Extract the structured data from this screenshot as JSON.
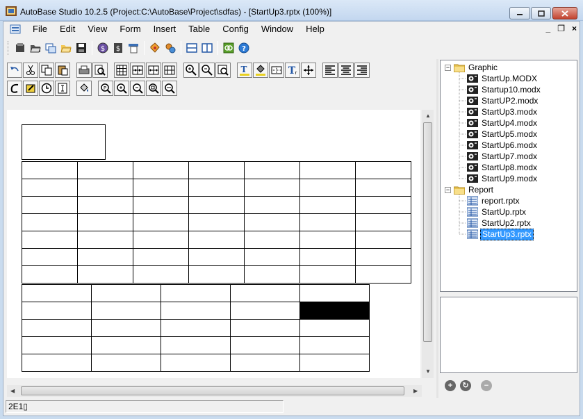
{
  "window": {
    "title": "AutoBase Studio 10.2.5 (Project:C:\\AutoBase\\Project\\sdfas) - [StartUp3.rptx (100%)]"
  },
  "menu": {
    "items": [
      "File",
      "Edit",
      "View",
      "Form",
      "Insert",
      "Table",
      "Config",
      "Window",
      "Help"
    ],
    "mdi_minimize": "_",
    "mdi_restore": "❐",
    "mdi_close": "×"
  },
  "toolbar_main": {
    "icons": [
      "new-project-icon",
      "open-folder-icon",
      "copy-window-icon",
      "open-file-icon",
      "save-icon",
      "dollar-coin-icon",
      "dollar-doc-icon",
      "script-icon",
      "tag-edit-icon",
      "settings-gear-icon",
      "split-horizontal-icon",
      "split-vertical-icon",
      "run-icon",
      "help-icon"
    ]
  },
  "report_toolbar_1": {
    "icons": [
      "undo-icon",
      "cut-icon",
      "copy-icon",
      "paste-icon",
      "print-icon",
      "print-preview-icon",
      "grid-icon",
      "insert-column-icon",
      "insert-row-icon",
      "merge-cells-icon",
      "zoom-in-icon",
      "zoom-out-icon",
      "zoom-fit-icon",
      "text-color-icon",
      "fill-color-icon",
      "border-icon",
      "font-icon",
      "move-icon",
      "align-left-icon",
      "align-center-icon",
      "align-right-icon"
    ]
  },
  "report_toolbar_2": {
    "icons": [
      "curve-icon",
      "highlight-icon",
      "clock-icon",
      "text-cursor-icon",
      "paint-bucket-icon",
      "zoom-icon",
      "zoom-plus-icon",
      "zoom-minus-icon",
      "zoom-page-icon",
      "zoom-width-icon"
    ]
  },
  "tree": {
    "groups": [
      {
        "label": "Graphic",
        "toggle": "−",
        "items": [
          "StartUp.MODX",
          "Startup10.modx",
          "StartUP2.modx",
          "StartUp3.modx",
          "StartUp4.modx",
          "StartUp5.modx",
          "StartUp6.modx",
          "StartUp7.modx",
          "StartUp8.modx",
          "StartUp9.modx"
        ]
      },
      {
        "label": "Report",
        "toggle": "−",
        "items": [
          "report.rptx",
          "StartUp.rptx",
          "StartUp2.rptx",
          "StartUp3.rptx"
        ]
      }
    ],
    "selected": "StartUp3.rptx"
  },
  "panel_buttons": {
    "add_label": "+",
    "refresh_label": "↻",
    "remove_label": "−"
  },
  "status": {
    "cell_ref": "2E1▯"
  },
  "colors": {
    "selection": "#3399ff",
    "selected_cell": "#000000",
    "title_gradient_top": "#dbe8f7",
    "title_gradient_bottom": "#c3d7ef"
  }
}
